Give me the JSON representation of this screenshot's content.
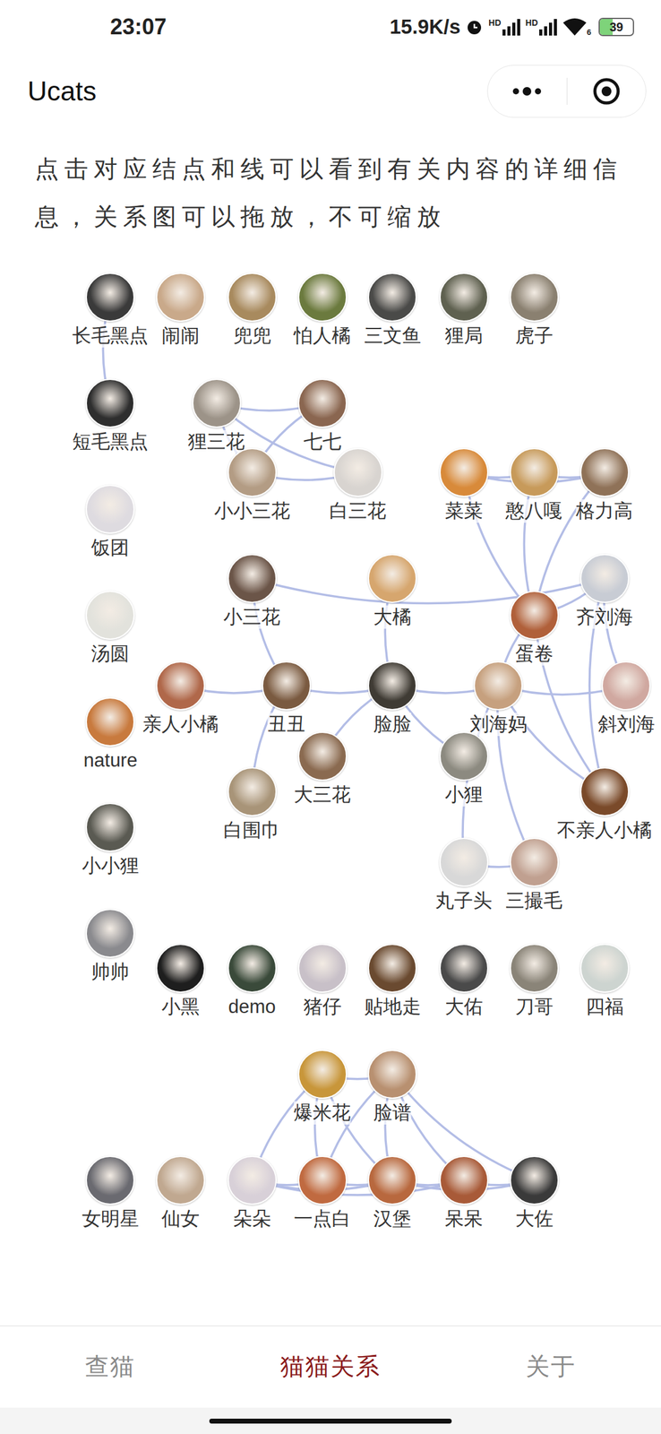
{
  "status_bar": {
    "time": "23:07",
    "speed": "15.9K/s",
    "signals": [
      "HD",
      "HD"
    ],
    "wifi_badge": "6",
    "battery": "39",
    "battery_level": 0.39
  },
  "header": {
    "title": "Ucats"
  },
  "description": "点击对应结点和线可以看到有关内容的详细信息，关系图可以拖放，不可缩放",
  "graph": {
    "nodes": [
      {
        "label": "长毛黑点"
      },
      {
        "label": "闹闹"
      },
      {
        "label": "兜兜"
      },
      {
        "label": "怕人橘"
      },
      {
        "label": "三文鱼"
      },
      {
        "label": "狸局"
      },
      {
        "label": "虎子"
      },
      {
        "label": "短毛黑点"
      },
      {
        "label": "狸三花"
      },
      {
        "label": "七七"
      },
      {
        "label": "小小三花"
      },
      {
        "label": "白三花"
      },
      {
        "label": "菜菜"
      },
      {
        "label": "憨八嘎"
      },
      {
        "label": "格力高"
      },
      {
        "label": "饭团"
      },
      {
        "label": "小三花"
      },
      {
        "label": "大橘"
      },
      {
        "label": "齐刘海"
      },
      {
        "label": "汤圆"
      },
      {
        "label": "蛋卷"
      },
      {
        "label": "亲人小橘"
      },
      {
        "label": "丑丑"
      },
      {
        "label": "脸脸"
      },
      {
        "label": "刘海妈"
      },
      {
        "label": "斜刘海"
      },
      {
        "label": "nature"
      },
      {
        "label": "大三花"
      },
      {
        "label": "小狸"
      },
      {
        "label": "白围巾"
      },
      {
        "label": "不亲人小橘"
      },
      {
        "label": "小小狸"
      },
      {
        "label": "丸子头"
      },
      {
        "label": "三撮毛"
      },
      {
        "label": "帅帅"
      },
      {
        "label": "小黑"
      },
      {
        "label": "demo"
      },
      {
        "label": "猪仔"
      },
      {
        "label": "贴地走"
      },
      {
        "label": "大佑"
      },
      {
        "label": "刀哥"
      },
      {
        "label": "四福"
      },
      {
        "label": "爆米花"
      },
      {
        "label": "脸谱"
      },
      {
        "label": "女明星"
      },
      {
        "label": "仙女"
      },
      {
        "label": "朵朵"
      },
      {
        "label": "一点白"
      },
      {
        "label": "汉堡"
      },
      {
        "label": "呆呆"
      },
      {
        "label": "大佐"
      }
    ],
    "edges": [
      {
        "from": "长毛黑点",
        "to": "短毛黑点"
      },
      {
        "from": "狸三花",
        "to": "七七"
      },
      {
        "from": "狸三花",
        "to": "小小三花"
      },
      {
        "from": "狸三花",
        "to": "白三花"
      },
      {
        "from": "七七",
        "to": "小小三花"
      },
      {
        "from": "小小三花",
        "to": "白三花"
      },
      {
        "from": "菜菜",
        "to": "憨八嘎"
      },
      {
        "from": "憨八嘎",
        "to": "格力高"
      },
      {
        "from": "菜菜",
        "to": "格力高"
      },
      {
        "from": "菜菜",
        "to": "蛋卷"
      },
      {
        "from": "憨八嘎",
        "to": "蛋卷"
      },
      {
        "from": "格力高",
        "to": "蛋卷"
      },
      {
        "from": "小三花",
        "to": "齐刘海"
      },
      {
        "from": "小三花",
        "to": "丑丑"
      },
      {
        "from": "蛋卷",
        "to": "齐刘海"
      },
      {
        "from": "齐刘海",
        "to": "斜刘海"
      },
      {
        "from": "齐刘海",
        "to": "不亲人小橘"
      },
      {
        "from": "蛋卷",
        "to": "不亲人小橘"
      },
      {
        "from": "蛋卷",
        "to": "刘海妈"
      },
      {
        "from": "刘海妈",
        "to": "斜刘海"
      },
      {
        "from": "刘海妈",
        "to": "不亲人小橘"
      },
      {
        "from": "刘海妈",
        "to": "丸子头"
      },
      {
        "from": "刘海妈",
        "to": "三撮毛"
      },
      {
        "from": "丸子头",
        "to": "三撮毛"
      },
      {
        "from": "脸脸",
        "to": "刘海妈"
      },
      {
        "from": "脸脸",
        "to": "小狸"
      },
      {
        "from": "大橘",
        "to": "脸脸"
      },
      {
        "from": "丑丑",
        "to": "脸脸"
      },
      {
        "from": "亲人小橘",
        "to": "丑丑"
      },
      {
        "from": "丑丑",
        "to": "白围巾"
      },
      {
        "from": "脸脸",
        "to": "大三花"
      },
      {
        "from": "爆米花",
        "to": "脸谱"
      },
      {
        "from": "爆米花",
        "to": "一点白"
      },
      {
        "from": "爆米花",
        "to": "汉堡"
      },
      {
        "from": "爆米花",
        "to": "朵朵"
      },
      {
        "from": "脸谱",
        "to": "一点白"
      },
      {
        "from": "脸谱",
        "to": "汉堡"
      },
      {
        "from": "脸谱",
        "to": "呆呆"
      },
      {
        "from": "脸谱",
        "to": "大佐"
      },
      {
        "from": "朵朵",
        "to": "一点白"
      },
      {
        "from": "朵朵",
        "to": "汉堡"
      },
      {
        "from": "一点白",
        "to": "汉堡"
      },
      {
        "from": "汉堡",
        "to": "呆呆"
      },
      {
        "from": "呆呆",
        "to": "大佐"
      },
      {
        "from": "汉堡",
        "to": "大佐"
      },
      {
        "from": "朵朵",
        "to": "呆呆"
      }
    ]
  },
  "tabs": [
    {
      "label": "查猫",
      "selected": false
    },
    {
      "label": "猫猫关系",
      "selected": true
    },
    {
      "label": "关于",
      "selected": false
    }
  ]
}
